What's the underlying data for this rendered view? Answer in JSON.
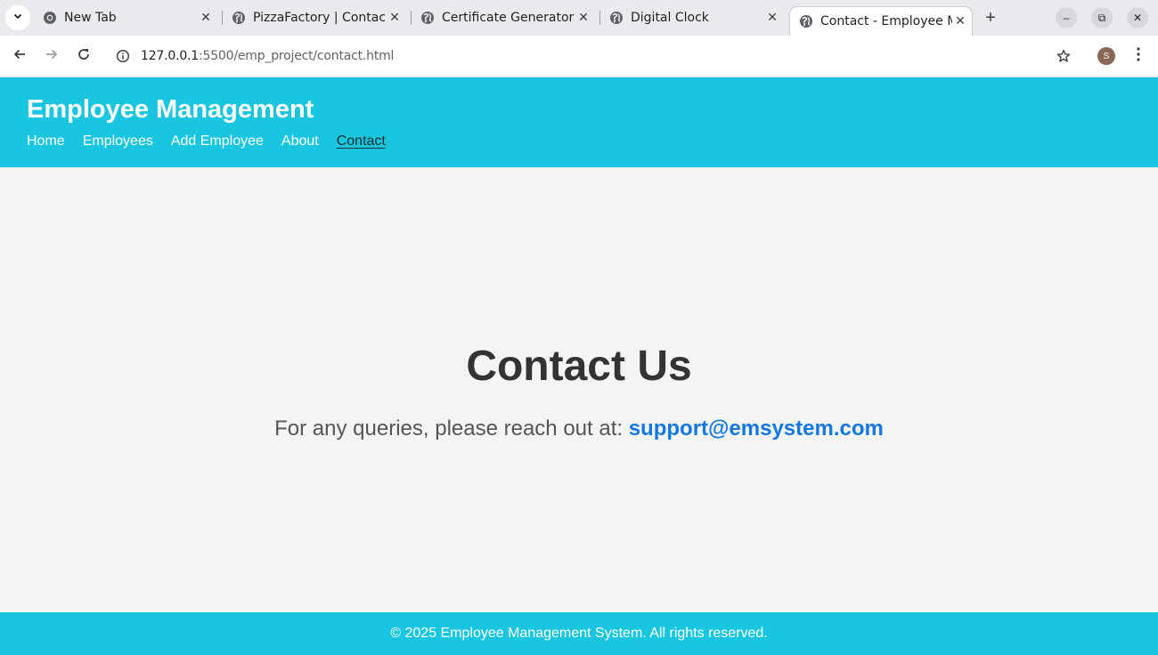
{
  "browser": {
    "tabs": [
      {
        "title": "New Tab",
        "favicon": "chrome-icon",
        "active": false
      },
      {
        "title": "PizzaFactory | Contac",
        "favicon": "globe-icon",
        "active": false
      },
      {
        "title": "Certificate Generator",
        "favicon": "globe-icon",
        "active": false
      },
      {
        "title": "Digital Clock",
        "favicon": "globe-icon",
        "active": false
      },
      {
        "title": "Contact - Employee M",
        "favicon": "globe-icon",
        "active": true
      }
    ],
    "new_tab_label": "+",
    "close_glyph": "✕",
    "window_controls": {
      "minimize": "–",
      "restore": "⧉",
      "close": "✕"
    },
    "url_host": "127.0.0.1",
    "url_path": ":5500/emp_project/contact.html",
    "profile_initial": "S"
  },
  "site": {
    "title": "Employee Management",
    "nav": [
      {
        "label": "Home",
        "current": false
      },
      {
        "label": "Employees",
        "current": false
      },
      {
        "label": "Add Employee",
        "current": false
      },
      {
        "label": "About",
        "current": false
      },
      {
        "label": "Contact",
        "current": true
      }
    ],
    "heading": "Contact Us",
    "contact_prefix": "For any queries, please reach out at:",
    "contact_email": "support@emsystem.com",
    "footer": "© 2025 Employee Management System. All rights reserved."
  },
  "colors": {
    "header_bg": "#1ac6df",
    "page_bg": "#f4f4f4",
    "link": "#1377e6",
    "heading": "#333333"
  }
}
